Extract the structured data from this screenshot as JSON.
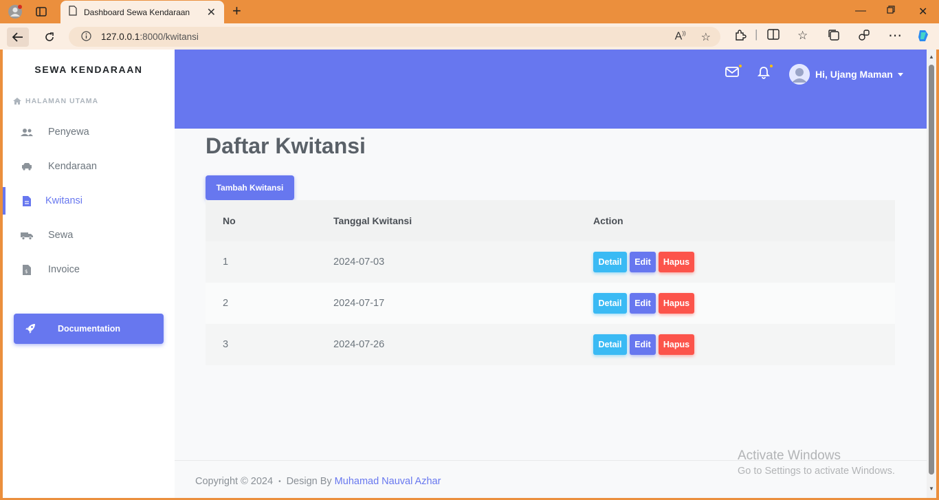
{
  "browser": {
    "tab_title": "Dashboard Sewa Kendaraan",
    "url_host": "127.0.0.1",
    "url_path": ":8000/kwitansi",
    "accent": "#eb8f3d"
  },
  "sidebar": {
    "brand": "SEWA KENDARAAN",
    "section_header": "HALAMAN UTAMA",
    "items": [
      {
        "label": "Penyewa",
        "icon": "users-icon"
      },
      {
        "label": "Kendaraan",
        "icon": "car-icon"
      },
      {
        "label": "Kwitansi",
        "icon": "file-icon",
        "active": true
      },
      {
        "label": "Sewa",
        "icon": "truck-icon"
      },
      {
        "label": "Invoice",
        "icon": "invoice-icon"
      }
    ],
    "doc_button": "Documentation"
  },
  "header": {
    "user_name": "Hi, Ujang Maman",
    "primary_color": "#6777ef"
  },
  "main": {
    "title": "Daftar Kwitansi",
    "add_button": "Tambah Kwitansi",
    "columns": [
      "No",
      "Tanggal Kwitansi",
      "Action"
    ],
    "rows": [
      {
        "no": "1",
        "date": "2024-07-03"
      },
      {
        "no": "2",
        "date": "2024-07-17"
      },
      {
        "no": "3",
        "date": "2024-07-26"
      }
    ],
    "actions": {
      "detail": "Detail",
      "edit": "Edit",
      "delete": "Hapus"
    }
  },
  "footer": {
    "copyright": "Copyright © 2024",
    "sep": "•",
    "design_by": "Design By",
    "author": "Muhamad Nauval Azhar"
  },
  "watermark": {
    "title": "Activate Windows",
    "subtitle": "Go to Settings to activate Windows."
  }
}
